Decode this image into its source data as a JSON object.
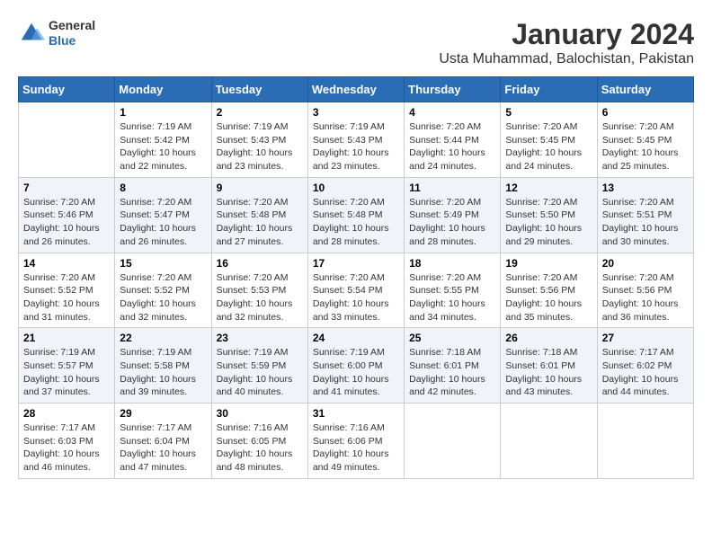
{
  "header": {
    "logo_general": "General",
    "logo_blue": "Blue",
    "title": "January 2024",
    "subtitle": "Usta Muhammad, Balochistan, Pakistan"
  },
  "days_of_week": [
    "Sunday",
    "Monday",
    "Tuesday",
    "Wednesday",
    "Thursday",
    "Friday",
    "Saturday"
  ],
  "weeks": [
    [
      {
        "day": "",
        "sunrise": "",
        "sunset": "",
        "daylight": ""
      },
      {
        "day": "1",
        "sunrise": "Sunrise: 7:19 AM",
        "sunset": "Sunset: 5:42 PM",
        "daylight": "Daylight: 10 hours and 22 minutes."
      },
      {
        "day": "2",
        "sunrise": "Sunrise: 7:19 AM",
        "sunset": "Sunset: 5:43 PM",
        "daylight": "Daylight: 10 hours and 23 minutes."
      },
      {
        "day": "3",
        "sunrise": "Sunrise: 7:19 AM",
        "sunset": "Sunset: 5:43 PM",
        "daylight": "Daylight: 10 hours and 23 minutes."
      },
      {
        "day": "4",
        "sunrise": "Sunrise: 7:20 AM",
        "sunset": "Sunset: 5:44 PM",
        "daylight": "Daylight: 10 hours and 24 minutes."
      },
      {
        "day": "5",
        "sunrise": "Sunrise: 7:20 AM",
        "sunset": "Sunset: 5:45 PM",
        "daylight": "Daylight: 10 hours and 24 minutes."
      },
      {
        "day": "6",
        "sunrise": "Sunrise: 7:20 AM",
        "sunset": "Sunset: 5:45 PM",
        "daylight": "Daylight: 10 hours and 25 minutes."
      }
    ],
    [
      {
        "day": "7",
        "sunrise": "Sunrise: 7:20 AM",
        "sunset": "Sunset: 5:46 PM",
        "daylight": "Daylight: 10 hours and 26 minutes."
      },
      {
        "day": "8",
        "sunrise": "Sunrise: 7:20 AM",
        "sunset": "Sunset: 5:47 PM",
        "daylight": "Daylight: 10 hours and 26 minutes."
      },
      {
        "day": "9",
        "sunrise": "Sunrise: 7:20 AM",
        "sunset": "Sunset: 5:48 PM",
        "daylight": "Daylight: 10 hours and 27 minutes."
      },
      {
        "day": "10",
        "sunrise": "Sunrise: 7:20 AM",
        "sunset": "Sunset: 5:48 PM",
        "daylight": "Daylight: 10 hours and 28 minutes."
      },
      {
        "day": "11",
        "sunrise": "Sunrise: 7:20 AM",
        "sunset": "Sunset: 5:49 PM",
        "daylight": "Daylight: 10 hours and 28 minutes."
      },
      {
        "day": "12",
        "sunrise": "Sunrise: 7:20 AM",
        "sunset": "Sunset: 5:50 PM",
        "daylight": "Daylight: 10 hours and 29 minutes."
      },
      {
        "day": "13",
        "sunrise": "Sunrise: 7:20 AM",
        "sunset": "Sunset: 5:51 PM",
        "daylight": "Daylight: 10 hours and 30 minutes."
      }
    ],
    [
      {
        "day": "14",
        "sunrise": "Sunrise: 7:20 AM",
        "sunset": "Sunset: 5:52 PM",
        "daylight": "Daylight: 10 hours and 31 minutes."
      },
      {
        "day": "15",
        "sunrise": "Sunrise: 7:20 AM",
        "sunset": "Sunset: 5:52 PM",
        "daylight": "Daylight: 10 hours and 32 minutes."
      },
      {
        "day": "16",
        "sunrise": "Sunrise: 7:20 AM",
        "sunset": "Sunset: 5:53 PM",
        "daylight": "Daylight: 10 hours and 32 minutes."
      },
      {
        "day": "17",
        "sunrise": "Sunrise: 7:20 AM",
        "sunset": "Sunset: 5:54 PM",
        "daylight": "Daylight: 10 hours and 33 minutes."
      },
      {
        "day": "18",
        "sunrise": "Sunrise: 7:20 AM",
        "sunset": "Sunset: 5:55 PM",
        "daylight": "Daylight: 10 hours and 34 minutes."
      },
      {
        "day": "19",
        "sunrise": "Sunrise: 7:20 AM",
        "sunset": "Sunset: 5:56 PM",
        "daylight": "Daylight: 10 hours and 35 minutes."
      },
      {
        "day": "20",
        "sunrise": "Sunrise: 7:20 AM",
        "sunset": "Sunset: 5:56 PM",
        "daylight": "Daylight: 10 hours and 36 minutes."
      }
    ],
    [
      {
        "day": "21",
        "sunrise": "Sunrise: 7:19 AM",
        "sunset": "Sunset: 5:57 PM",
        "daylight": "Daylight: 10 hours and 37 minutes."
      },
      {
        "day": "22",
        "sunrise": "Sunrise: 7:19 AM",
        "sunset": "Sunset: 5:58 PM",
        "daylight": "Daylight: 10 hours and 39 minutes."
      },
      {
        "day": "23",
        "sunrise": "Sunrise: 7:19 AM",
        "sunset": "Sunset: 5:59 PM",
        "daylight": "Daylight: 10 hours and 40 minutes."
      },
      {
        "day": "24",
        "sunrise": "Sunrise: 7:19 AM",
        "sunset": "Sunset: 6:00 PM",
        "daylight": "Daylight: 10 hours and 41 minutes."
      },
      {
        "day": "25",
        "sunrise": "Sunrise: 7:18 AM",
        "sunset": "Sunset: 6:01 PM",
        "daylight": "Daylight: 10 hours and 42 minutes."
      },
      {
        "day": "26",
        "sunrise": "Sunrise: 7:18 AM",
        "sunset": "Sunset: 6:01 PM",
        "daylight": "Daylight: 10 hours and 43 minutes."
      },
      {
        "day": "27",
        "sunrise": "Sunrise: 7:17 AM",
        "sunset": "Sunset: 6:02 PM",
        "daylight": "Daylight: 10 hours and 44 minutes."
      }
    ],
    [
      {
        "day": "28",
        "sunrise": "Sunrise: 7:17 AM",
        "sunset": "Sunset: 6:03 PM",
        "daylight": "Daylight: 10 hours and 46 minutes."
      },
      {
        "day": "29",
        "sunrise": "Sunrise: 7:17 AM",
        "sunset": "Sunset: 6:04 PM",
        "daylight": "Daylight: 10 hours and 47 minutes."
      },
      {
        "day": "30",
        "sunrise": "Sunrise: 7:16 AM",
        "sunset": "Sunset: 6:05 PM",
        "daylight": "Daylight: 10 hours and 48 minutes."
      },
      {
        "day": "31",
        "sunrise": "Sunrise: 7:16 AM",
        "sunset": "Sunset: 6:06 PM",
        "daylight": "Daylight: 10 hours and 49 minutes."
      },
      {
        "day": "",
        "sunrise": "",
        "sunset": "",
        "daylight": ""
      },
      {
        "day": "",
        "sunrise": "",
        "sunset": "",
        "daylight": ""
      },
      {
        "day": "",
        "sunrise": "",
        "sunset": "",
        "daylight": ""
      }
    ]
  ]
}
